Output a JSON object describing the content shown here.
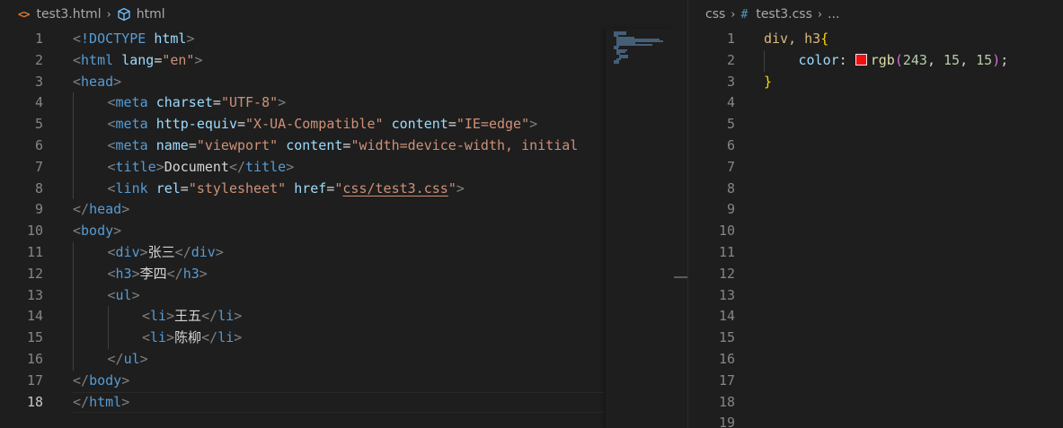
{
  "left_editor": {
    "breadcrumb": {
      "file": "test3.html",
      "symbol": "html"
    },
    "active_line": 18,
    "lines": [
      {
        "n": "1",
        "indent": 0,
        "tokens": [
          [
            "t-p",
            "<"
          ],
          [
            "t-tag",
            "!DOCTYPE"
          ],
          [
            "t-text",
            " "
          ],
          [
            "t-attr",
            "html"
          ],
          [
            "t-p",
            ">"
          ]
        ]
      },
      {
        "n": "2",
        "indent": 0,
        "tokens": [
          [
            "t-p",
            "<"
          ],
          [
            "t-tag",
            "html"
          ],
          [
            "t-text",
            " "
          ],
          [
            "t-attr",
            "lang"
          ],
          [
            "t-text",
            "="
          ],
          [
            "t-str",
            "\"en\""
          ],
          [
            "t-p",
            ">"
          ]
        ]
      },
      {
        "n": "3",
        "indent": 0,
        "tokens": [
          [
            "t-p",
            "<"
          ],
          [
            "t-tag",
            "head"
          ],
          [
            "t-p",
            ">"
          ]
        ]
      },
      {
        "n": "4",
        "indent": 1,
        "tokens": [
          [
            "t-p",
            "<"
          ],
          [
            "t-tag",
            "meta"
          ],
          [
            "t-text",
            " "
          ],
          [
            "t-attr",
            "charset"
          ],
          [
            "t-text",
            "="
          ],
          [
            "t-str",
            "\"UTF-8\""
          ],
          [
            "t-p",
            ">"
          ]
        ]
      },
      {
        "n": "5",
        "indent": 1,
        "tokens": [
          [
            "t-p",
            "<"
          ],
          [
            "t-tag",
            "meta"
          ],
          [
            "t-text",
            " "
          ],
          [
            "t-attr",
            "http-equiv"
          ],
          [
            "t-text",
            "="
          ],
          [
            "t-str",
            "\"X-UA-Compatible\""
          ],
          [
            "t-text",
            " "
          ],
          [
            "t-attr",
            "content"
          ],
          [
            "t-text",
            "="
          ],
          [
            "t-str",
            "\"IE=edge\""
          ],
          [
            "t-p",
            ">"
          ]
        ]
      },
      {
        "n": "6",
        "indent": 1,
        "tokens": [
          [
            "t-p",
            "<"
          ],
          [
            "t-tag",
            "meta"
          ],
          [
            "t-text",
            " "
          ],
          [
            "t-attr",
            "name"
          ],
          [
            "t-text",
            "="
          ],
          [
            "t-str",
            "\"viewport\""
          ],
          [
            "t-text",
            " "
          ],
          [
            "t-attr",
            "content"
          ],
          [
            "t-text",
            "="
          ],
          [
            "t-str",
            "\"width=device-width, initial"
          ]
        ]
      },
      {
        "n": "7",
        "indent": 1,
        "tokens": [
          [
            "t-p",
            "<"
          ],
          [
            "t-tag",
            "title"
          ],
          [
            "t-p",
            ">"
          ],
          [
            "t-text",
            "Document"
          ],
          [
            "t-p",
            "</"
          ],
          [
            "t-tag",
            "title"
          ],
          [
            "t-p",
            ">"
          ]
        ]
      },
      {
        "n": "8",
        "indent": 1,
        "tokens": [
          [
            "t-p",
            "<"
          ],
          [
            "t-tag",
            "link"
          ],
          [
            "t-text",
            " "
          ],
          [
            "t-attr",
            "rel"
          ],
          [
            "t-text",
            "="
          ],
          [
            "t-str",
            "\"stylesheet\""
          ],
          [
            "t-text",
            " "
          ],
          [
            "t-attr",
            "href"
          ],
          [
            "t-text",
            "="
          ],
          [
            "t-str",
            "\""
          ],
          [
            "t-link",
            "css/test3.css"
          ],
          [
            "t-str",
            "\""
          ],
          [
            "t-p",
            ">"
          ]
        ]
      },
      {
        "n": "9",
        "indent": 0,
        "tokens": [
          [
            "t-p",
            "</"
          ],
          [
            "t-tag",
            "head"
          ],
          [
            "t-p",
            ">"
          ]
        ]
      },
      {
        "n": "10",
        "indent": 0,
        "tokens": [
          [
            "t-p",
            "<"
          ],
          [
            "t-tag",
            "body"
          ],
          [
            "t-p",
            ">"
          ]
        ]
      },
      {
        "n": "11",
        "indent": 1,
        "tokens": [
          [
            "t-p",
            "<"
          ],
          [
            "t-tag",
            "div"
          ],
          [
            "t-p",
            ">"
          ],
          [
            "t-text",
            "张三"
          ],
          [
            "t-p",
            "</"
          ],
          [
            "t-tag",
            "div"
          ],
          [
            "t-p",
            ">"
          ]
        ]
      },
      {
        "n": "12",
        "indent": 1,
        "tokens": [
          [
            "t-p",
            "<"
          ],
          [
            "t-tag",
            "h3"
          ],
          [
            "t-p",
            ">"
          ],
          [
            "t-text",
            "李四"
          ],
          [
            "t-p",
            "</"
          ],
          [
            "t-tag",
            "h3"
          ],
          [
            "t-p",
            ">"
          ]
        ]
      },
      {
        "n": "13",
        "indent": 1,
        "tokens": [
          [
            "t-p",
            "<"
          ],
          [
            "t-tag",
            "ul"
          ],
          [
            "t-p",
            ">"
          ]
        ]
      },
      {
        "n": "14",
        "indent": 2,
        "tokens": [
          [
            "t-p",
            "<"
          ],
          [
            "t-tag",
            "li"
          ],
          [
            "t-p",
            ">"
          ],
          [
            "t-text",
            "王五"
          ],
          [
            "t-p",
            "</"
          ],
          [
            "t-tag",
            "li"
          ],
          [
            "t-p",
            ">"
          ]
        ]
      },
      {
        "n": "15",
        "indent": 2,
        "tokens": [
          [
            "t-p",
            "<"
          ],
          [
            "t-tag",
            "li"
          ],
          [
            "t-p",
            ">"
          ],
          [
            "t-text",
            "陈柳"
          ],
          [
            "t-p",
            "</"
          ],
          [
            "t-tag",
            "li"
          ],
          [
            "t-p",
            ">"
          ]
        ]
      },
      {
        "n": "16",
        "indent": 1,
        "tokens": [
          [
            "t-p",
            "</"
          ],
          [
            "t-tag",
            "ul"
          ],
          [
            "t-p",
            ">"
          ]
        ]
      },
      {
        "n": "17",
        "indent": 0,
        "tokens": [
          [
            "t-p",
            "</"
          ],
          [
            "t-tag",
            "body"
          ],
          [
            "t-p",
            ">"
          ]
        ]
      },
      {
        "n": "18",
        "indent": 0,
        "tokens": [
          [
            "t-p",
            "</"
          ],
          [
            "t-tag",
            "html"
          ],
          [
            "t-p",
            ">"
          ]
        ]
      }
    ]
  },
  "right_editor": {
    "breadcrumb": {
      "folder": "css",
      "file": "test3.css",
      "symbol": "..."
    },
    "swatch_color": "#f30f0f",
    "lines": [
      {
        "n": "1",
        "indent": 0,
        "tokens": [
          [
            "t-sel",
            "div, h3"
          ],
          [
            "t-brace",
            "{"
          ]
        ]
      },
      {
        "n": "2",
        "indent": 1,
        "tokens": [
          [
            "t-prop",
            "color"
          ],
          [
            "t-text",
            ": "
          ],
          [
            "swatch",
            ""
          ],
          [
            "t-fn",
            "rgb"
          ],
          [
            "t-paren",
            "("
          ],
          [
            "t-num",
            "243"
          ],
          [
            "t-text",
            ", "
          ],
          [
            "t-num",
            "15"
          ],
          [
            "t-text",
            ", "
          ],
          [
            "t-num",
            "15"
          ],
          [
            "t-paren",
            ")"
          ],
          [
            "t-text",
            ";"
          ]
        ]
      },
      {
        "n": "3",
        "indent": 0,
        "tokens": [
          [
            "t-brace",
            "}"
          ]
        ]
      },
      {
        "n": "4",
        "indent": 0,
        "tokens": []
      },
      {
        "n": "5",
        "indent": 0,
        "tokens": []
      },
      {
        "n": "6",
        "indent": 0,
        "tokens": []
      },
      {
        "n": "7",
        "indent": 0,
        "tokens": []
      },
      {
        "n": "8",
        "indent": 0,
        "tokens": []
      },
      {
        "n": "9",
        "indent": 0,
        "tokens": []
      },
      {
        "n": "10",
        "indent": 0,
        "tokens": []
      },
      {
        "n": "11",
        "indent": 0,
        "tokens": []
      },
      {
        "n": "12",
        "indent": 0,
        "tokens": []
      },
      {
        "n": "13",
        "indent": 0,
        "tokens": []
      },
      {
        "n": "14",
        "indent": 0,
        "tokens": []
      },
      {
        "n": "15",
        "indent": 0,
        "tokens": []
      },
      {
        "n": "16",
        "indent": 0,
        "tokens": []
      },
      {
        "n": "17",
        "indent": 0,
        "tokens": []
      },
      {
        "n": "18",
        "indent": 0,
        "tokens": []
      },
      {
        "n": "19",
        "indent": 0,
        "tokens": []
      }
    ]
  },
  "icons": {
    "html_file": "html-file-icon",
    "symbol": "cube-icon",
    "css_file": "hash-icon",
    "separator": "chevron-right-icon"
  }
}
